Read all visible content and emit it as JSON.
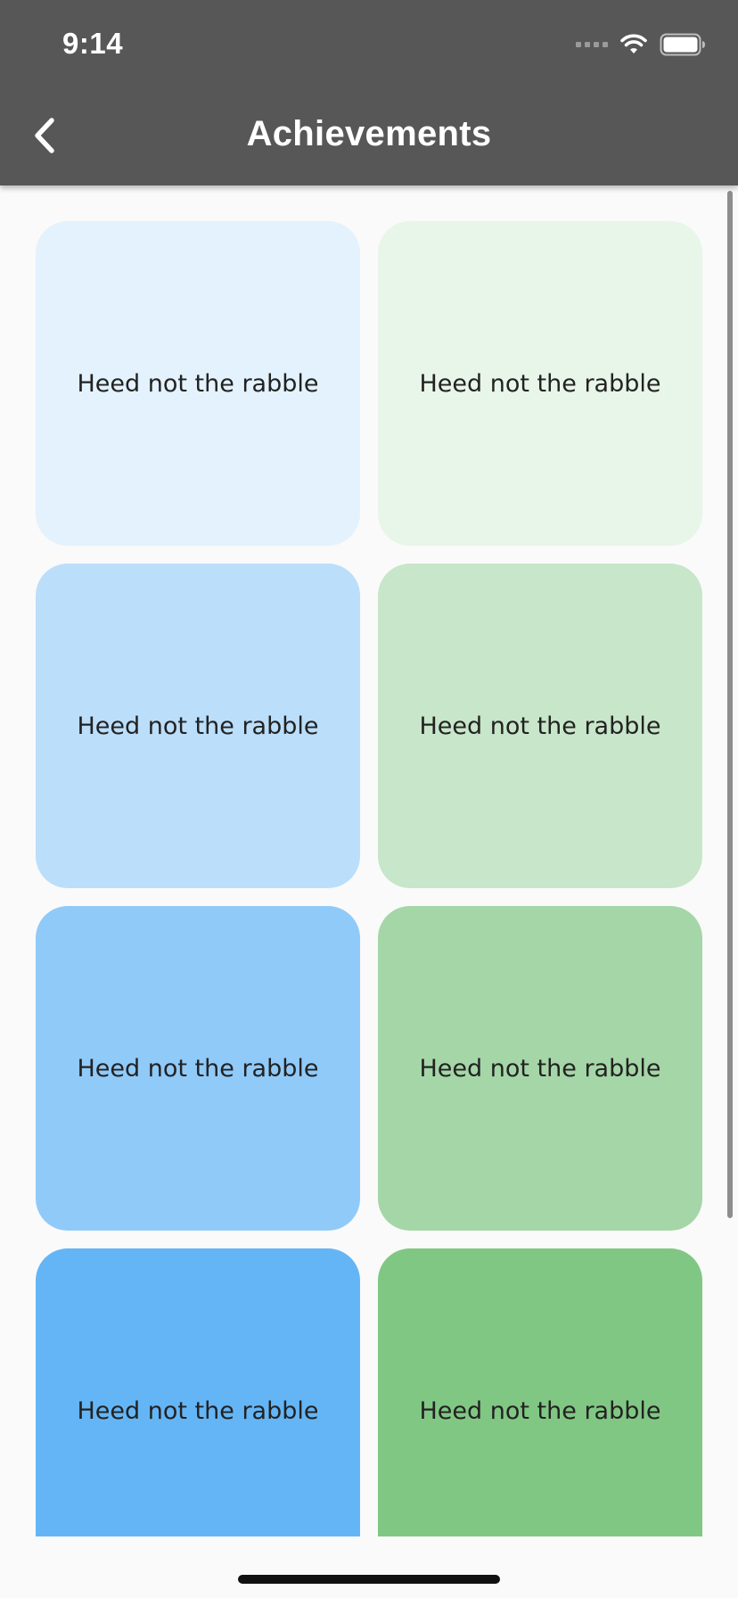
{
  "status_bar": {
    "time": "9:14",
    "signal_icon": "signal-icon",
    "wifi_icon": "wifi-icon",
    "battery_icon": "battery-icon"
  },
  "app_bar": {
    "title": "Achievements",
    "back_icon": "chevron-left-icon",
    "background_color": "#575757"
  },
  "tiles": [
    {
      "label": "Heed not the rabble",
      "color": "#e3f2fd"
    },
    {
      "label": "Heed not the rabble",
      "color": "#e8f5e9"
    },
    {
      "label": "Heed not the rabble",
      "color": "#bbdefb"
    },
    {
      "label": "Heed not the rabble",
      "color": "#c8e6c9"
    },
    {
      "label": "Heed not the rabble",
      "color": "#90caf9"
    },
    {
      "label": "Heed not the rabble",
      "color": "#a5d6a7"
    },
    {
      "label": "Heed not the rabble",
      "color": "#64b5f6"
    },
    {
      "label": "Heed not the rabble",
      "color": "#81c784"
    }
  ]
}
